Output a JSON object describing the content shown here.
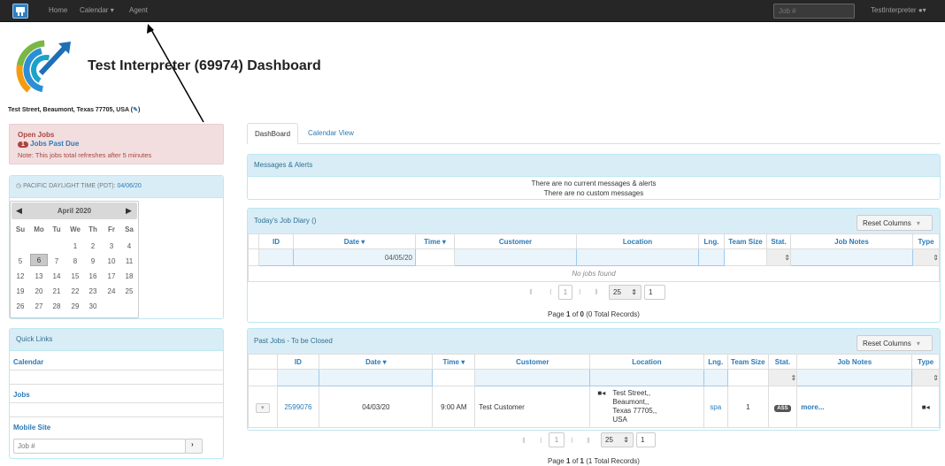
{
  "nav": {
    "home": "Home",
    "calendar": "Calendar",
    "agent": "Agent",
    "job_placeholder": "Job #",
    "user": "TestInterpreter"
  },
  "header": {
    "title": "Test Interpreter (69974) Dashboard",
    "address": "Test Street, Beaumont, Texas 77705, USA ("
  },
  "open_jobs": {
    "title": "Open Jobs",
    "count": "1",
    "link": "Jobs Past Due",
    "note": "Note: This jobs total refreshes after 5 minutes"
  },
  "time_panel": {
    "label": "PACIFIC DAYLIGHT TIME (PDT):",
    "date": "04/06/20"
  },
  "calendar": {
    "month": "April 2020",
    "weekdays": [
      "Su",
      "Mo",
      "Tu",
      "We",
      "Th",
      "Fr",
      "Sa"
    ],
    "weeks": [
      [
        "",
        "",
        "",
        "1",
        "2",
        "3",
        "4"
      ],
      [
        "5",
        "6",
        "7",
        "8",
        "9",
        "10",
        "11"
      ],
      [
        "12",
        "13",
        "14",
        "15",
        "16",
        "17",
        "18"
      ],
      [
        "19",
        "20",
        "21",
        "22",
        "23",
        "24",
        "25"
      ],
      [
        "26",
        "27",
        "28",
        "29",
        "30",
        "",
        ""
      ]
    ],
    "selected": "6"
  },
  "quick_links": {
    "title": "Quick Links",
    "items": [
      "Calendar",
      "Jobs",
      "Mobile Site"
    ],
    "job_placeholder": "Job #",
    "go": "›"
  },
  "tabs": [
    "DashBoard",
    "Calendar View"
  ],
  "messages": {
    "title": "Messages & Alerts",
    "line1": "There are no current messages & alerts",
    "line2": "There are no custom messages"
  },
  "diary": {
    "title": "Today's Job Diary ()",
    "reset": "Reset Columns",
    "columns": [
      "ID",
      "Date ▾",
      "Time ▾",
      "Customer",
      "Location",
      "Lng.",
      "Team Size",
      "Stat.",
      "Job Notes",
      "Type"
    ],
    "date_filter": "04/05/20",
    "empty": "No jobs found",
    "page_size": "25",
    "page": "1",
    "footer_pre": "Page ",
    "footer_page": "1",
    "footer_mid": " of ",
    "footer_total": "0",
    "footer_post": " (0 Total Records)"
  },
  "past": {
    "title": "Past Jobs - To be Closed",
    "reset": "Reset Columns",
    "columns": [
      "ID",
      "Date ▾",
      "Time ▾",
      "Customer",
      "Location",
      "Lng.",
      "Team Size",
      "Stat.",
      "Job Notes",
      "Type"
    ],
    "row": {
      "id": "2599076",
      "date": "04/03/20",
      "time": "9:00 AM",
      "customer": "Test Customer",
      "location_lines": [
        "Test Street,,",
        "Beaumont,,",
        "Texas 77705,,",
        "USA"
      ],
      "lng": "spa",
      "team": "1",
      "status": "ASS",
      "notes": "more..."
    },
    "page_size": "25",
    "page": "1",
    "footer_pre": "Page ",
    "footer_page": "1",
    "footer_mid": " of ",
    "footer_total": "1",
    "footer_post": " (1 Total Records)"
  },
  "colors": {
    "navbar": "#262626",
    "link": "#2a7ab8",
    "panel_head": "#d9edf7",
    "alert_bg": "#f2dede",
    "alert_text": "#a94442"
  }
}
